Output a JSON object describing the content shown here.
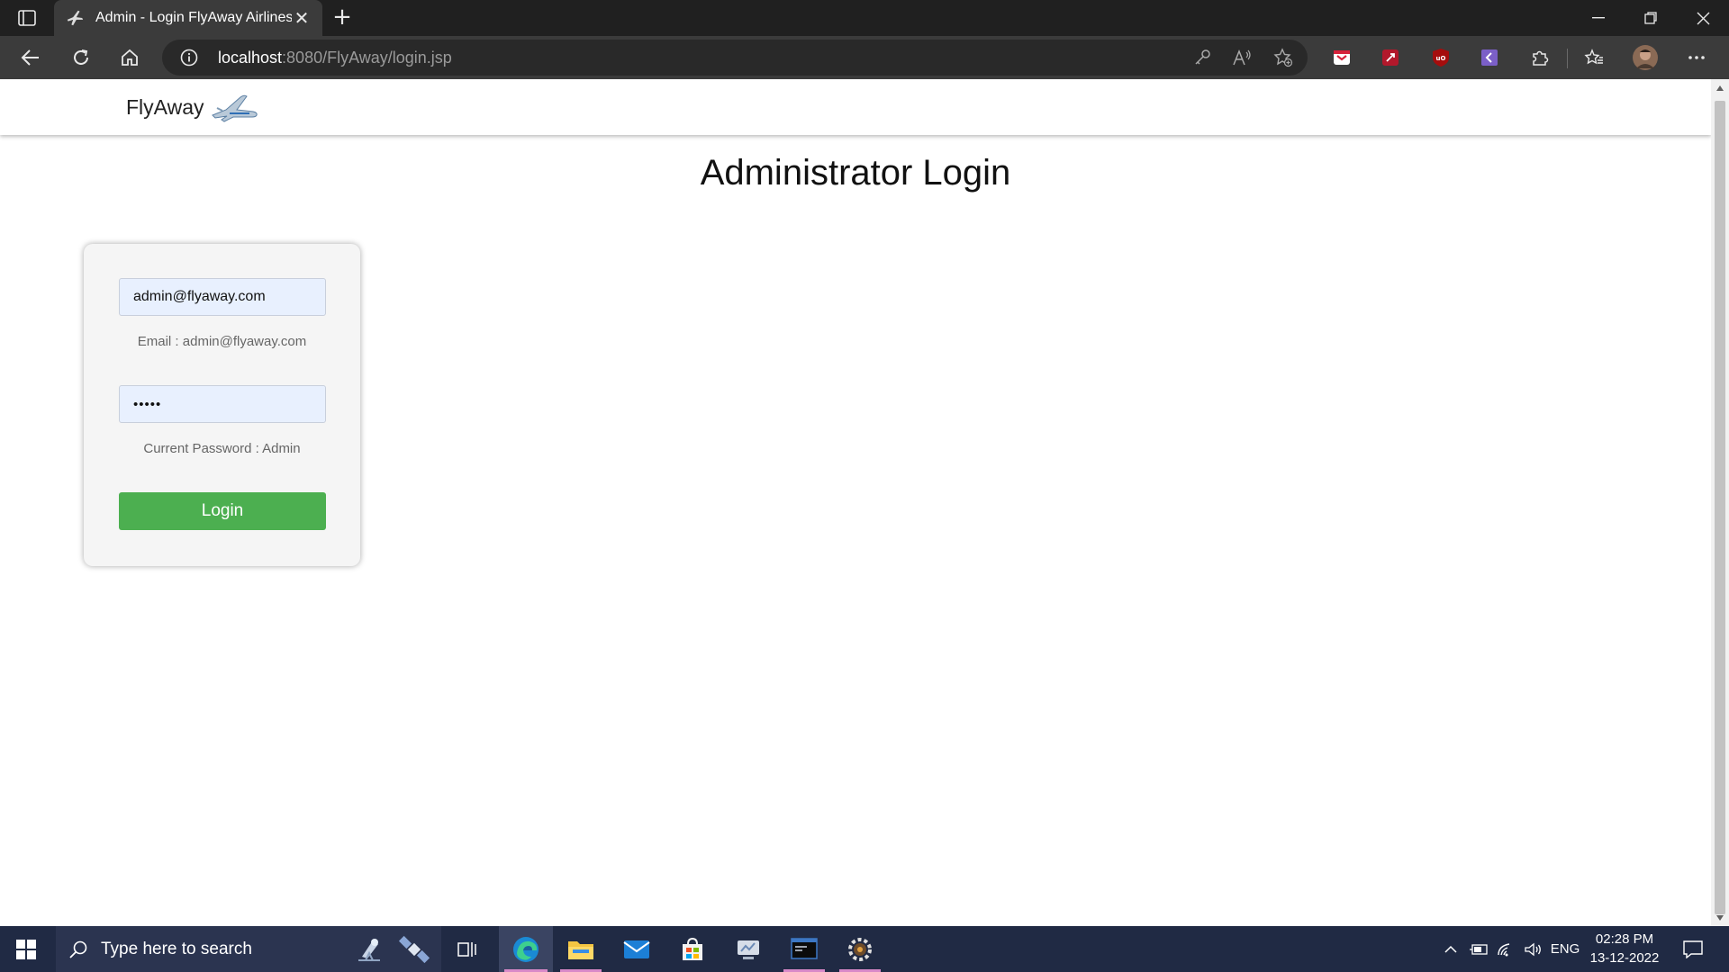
{
  "browser": {
    "tab_title": "Admin - Login FlyAway Airlines",
    "url_host": "localhost",
    "url_rest": ":8080/FlyAway/login.jsp"
  },
  "site": {
    "brand": "FlyAway",
    "page_title": "Administrator Login"
  },
  "login_form": {
    "email_value": "admin@flyaway.com",
    "email_hint": "Email : admin@flyaway.com",
    "password_value": "•••••",
    "password_hint": "Current Password : Admin",
    "login_label": "Login"
  },
  "taskbar": {
    "search_placeholder": "Type here to search",
    "language": "ENG",
    "time": "02:28 PM",
    "date": "13-12-2022"
  },
  "colors": {
    "login_button": "#4caf50",
    "input_fill": "#e8f0fe",
    "taskbar": "#202a44"
  }
}
